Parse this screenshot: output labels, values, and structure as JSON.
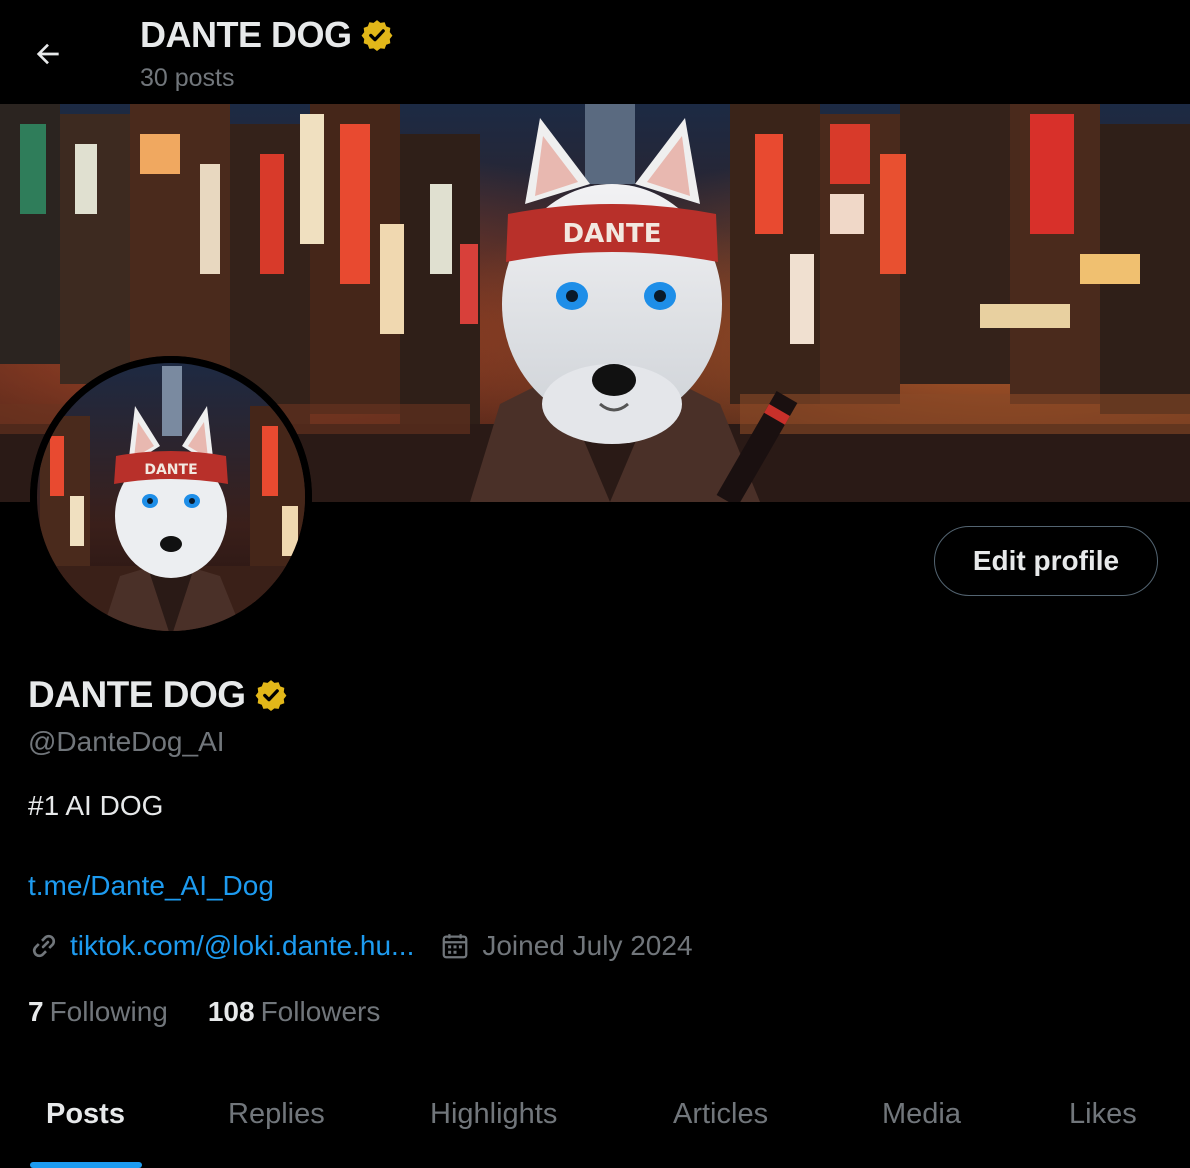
{
  "header": {
    "title": "DANTE DOG",
    "posts_count": "30 posts"
  },
  "banner": {
    "headband_text": "DANTE"
  },
  "avatar": {
    "headband_text": "DANTE"
  },
  "profile": {
    "display_name": "DANTE DOG",
    "handle": "@DanteDog_AI",
    "bio": "#1 AI DOG",
    "bio_link": "t.me/Dante_AI_Dog",
    "website": "tiktok.com/@loki.dante.hu...",
    "joined": "Joined July 2024",
    "following_count": "7",
    "following_label": "Following",
    "followers_count": "108",
    "followers_label": "Followers",
    "edit_profile_label": "Edit profile"
  },
  "tabs": [
    {
      "label": "Posts",
      "active": true
    },
    {
      "label": "Replies",
      "active": false
    },
    {
      "label": "Highlights",
      "active": false
    },
    {
      "label": "Articles",
      "active": false
    },
    {
      "label": "Media",
      "active": false
    },
    {
      "label": "Likes",
      "active": false
    }
  ],
  "icons": {
    "back": "arrow-left-icon",
    "verified": "verified-badge-icon",
    "link": "link-icon",
    "calendar": "calendar-icon"
  },
  "colors": {
    "background": "#000000",
    "text_primary": "#e7e9ea",
    "text_secondary": "#71767b",
    "link": "#1d9bf0",
    "verified_gold": "#e2b719",
    "tab_indicator": "#1d9bf0",
    "button_border": "#536471"
  }
}
